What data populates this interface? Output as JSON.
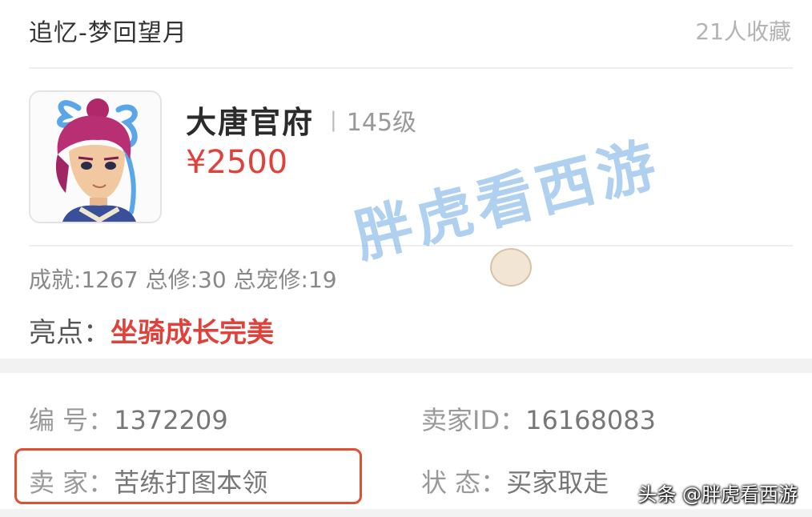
{
  "header": {
    "server_name": "追忆-梦回望月",
    "favorites": "21人收藏"
  },
  "character": {
    "avatar_icon": "character-portrait-icon",
    "school": "大唐官府",
    "separator": "|",
    "level": "145级",
    "price": "¥2500"
  },
  "stats": {
    "text": "成就:1267 总修:30 总宠修:19"
  },
  "highlight": {
    "label": "亮点：",
    "value": "坐骑成长完美"
  },
  "info": {
    "serial_label": "编  号：",
    "serial_value": "1372209",
    "seller_id_label": "卖家ID：",
    "seller_id_value": "16168083",
    "seller_label": "卖  家：",
    "seller_value": "苦练打图本领",
    "status_label": "状  态：",
    "status_value": "买家取走"
  },
  "watermark": {
    "text": "胖虎看西游"
  },
  "credit": {
    "text": "头条 @胖虎看西游"
  },
  "colors": {
    "price": "#e0413a",
    "highlight": "#e0413a",
    "seller_box": "#e05030"
  }
}
